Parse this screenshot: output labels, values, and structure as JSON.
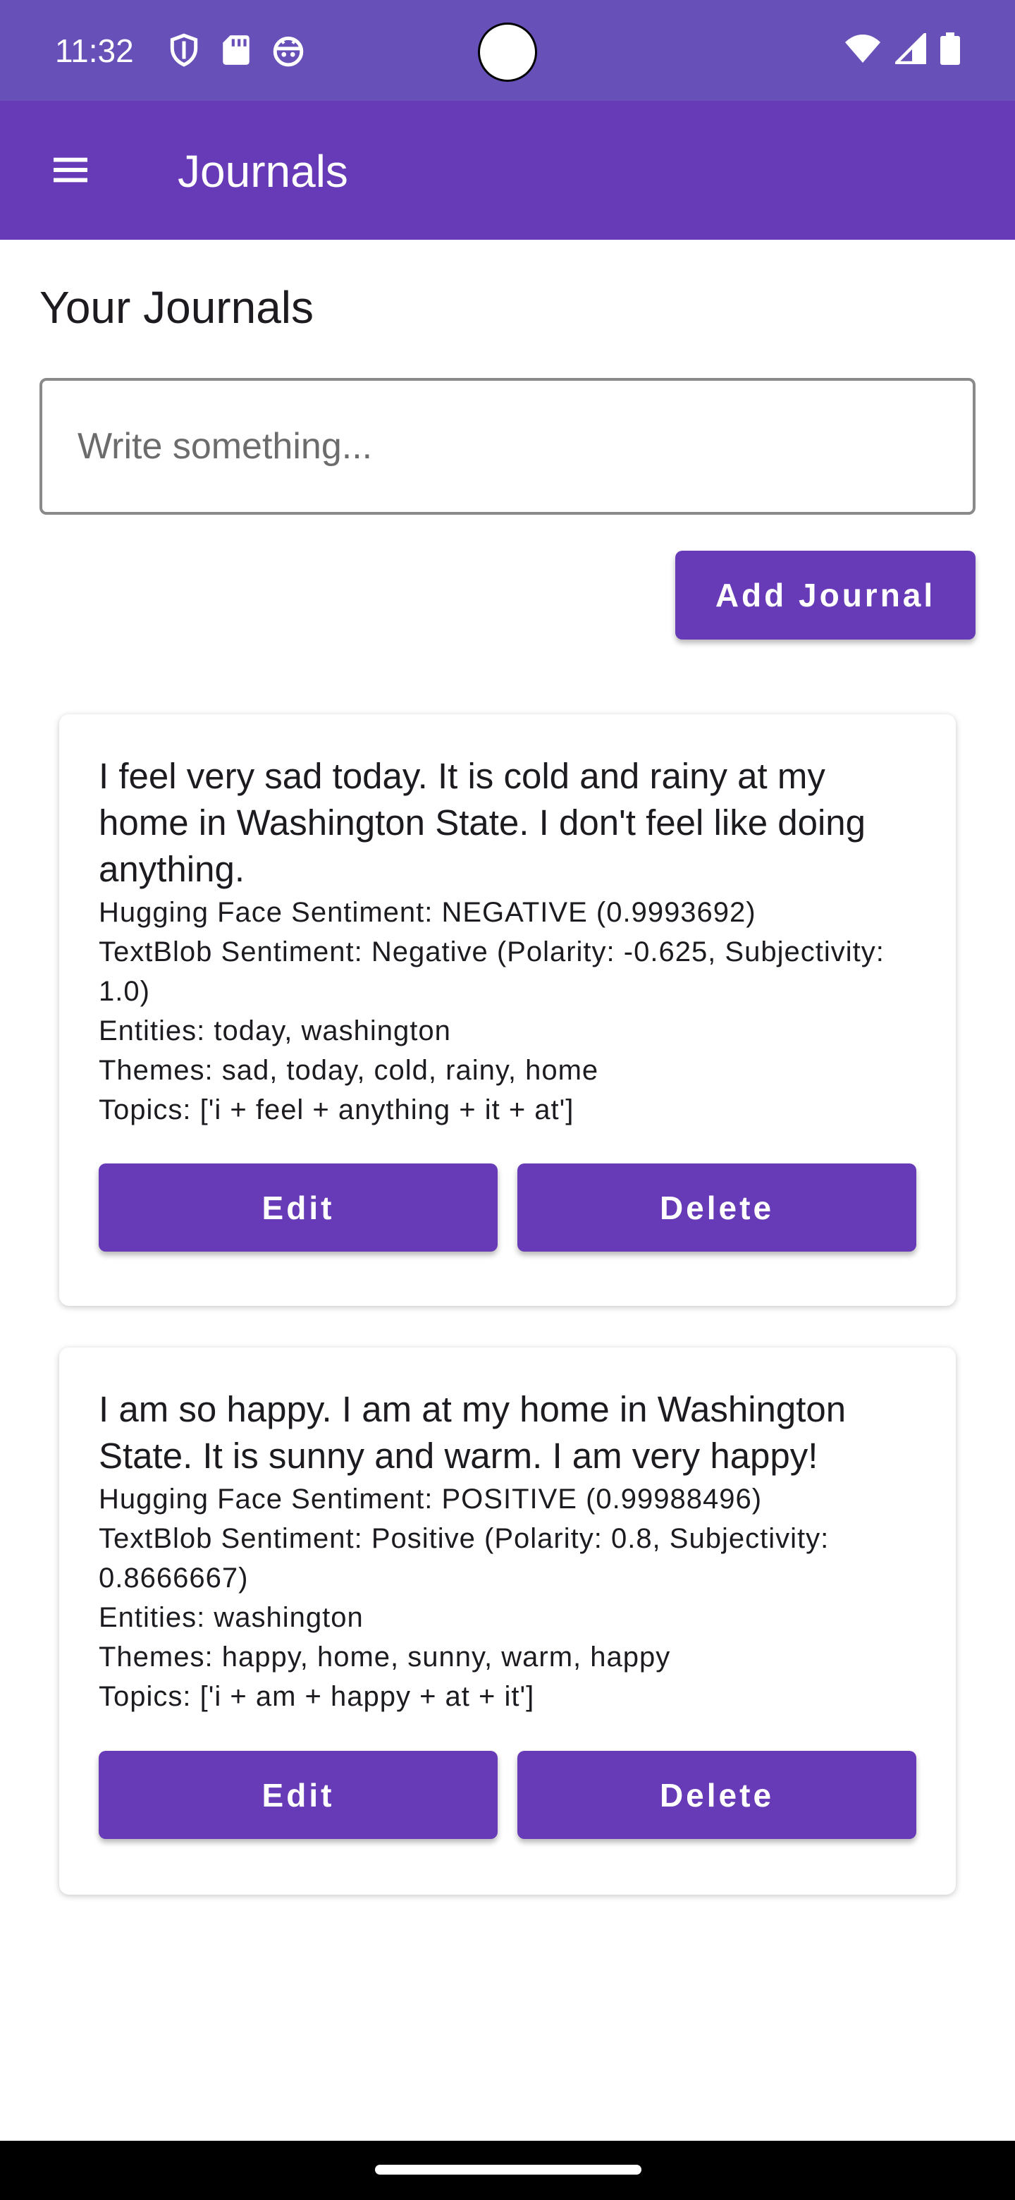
{
  "status_bar": {
    "time": "11:32",
    "left_icons": [
      "shield-icon",
      "sd-card-icon",
      "android-icon"
    ],
    "right_icons": [
      "wifi-icon",
      "signal-icon",
      "battery-icon"
    ],
    "color": "#6750b8"
  },
  "app_bar": {
    "title": "Journals",
    "menu_icon": "hamburger-menu-icon",
    "color": "#673ab7"
  },
  "main": {
    "heading": "Your Journals",
    "input": {
      "placeholder": "Write something...",
      "value": ""
    },
    "add_button_label": "Add Journal"
  },
  "journals": [
    {
      "text": "I feel very sad today. It is cold and rainy at my home in Washington State. I don't feel like doing anything.",
      "hugging_face": "Hugging Face Sentiment: NEGATIVE (0.9993692)",
      "textblob": "TextBlob Sentiment: Negative (Polarity: -0.625, Subjectivity: 1.0)",
      "entities": "Entities: today, washington",
      "themes": "Themes: sad, today, cold, rainy, home",
      "topics": "Topics: ['i + feel + anything + it + at']",
      "edit_label": "Edit",
      "delete_label": "Delete"
    },
    {
      "text": "I am so happy. I am at my home in Washington State. It is sunny and warm. I am very happy!",
      "hugging_face": "Hugging Face Sentiment: POSITIVE (0.99988496)",
      "textblob": "TextBlob Sentiment: Positive (Polarity: 0.8, Subjectivity: 0.8666667)",
      "entities": "Entities: washington",
      "themes": "Themes: happy, home, sunny, warm, happy",
      "topics": "Topics: ['i + am + happy + at + it']",
      "edit_label": "Edit",
      "delete_label": "Delete"
    }
  ],
  "colors": {
    "accent": "#673ab7",
    "button_text": "#ffffff",
    "text": "#1d1b20"
  }
}
